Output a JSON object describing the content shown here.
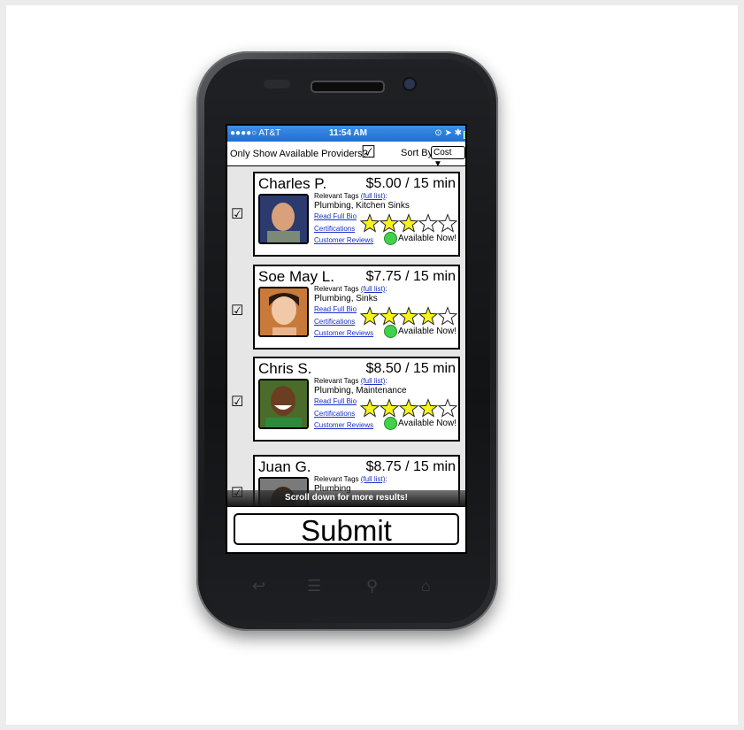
{
  "status_bar": {
    "carrier": "●●●●○ AT&T",
    "time": "11:54 AM",
    "battery_color": "#4ad04a"
  },
  "filter": {
    "available_label": "Only Show Available Providers?",
    "available_checked": true,
    "sort_label": "Sort By:",
    "sort_value": "Cost ▼"
  },
  "tags_label": "Relevant Tags",
  "full_list_link": "(full list)",
  "links": {
    "bio": "Read Full Bio",
    "certs": "Certifications",
    "reviews": "Customer Reviews"
  },
  "available_text": "Available Now!",
  "providers": [
    {
      "name": "Charles P.",
      "price": "$5.00 / 15 min",
      "tags": "Plumbing, Kitchen Sinks",
      "rating": 3,
      "checked": true
    },
    {
      "name": "Soe May L.",
      "price": "$7.75 / 15 min",
      "tags": "Plumbing, Sinks",
      "rating": 4,
      "checked": true
    },
    {
      "name": "Chris S.",
      "price": "$8.50 / 15 min",
      "tags": "Plumbing, Maintenance",
      "rating": 4,
      "checked": true
    },
    {
      "name": "Juan G.",
      "price": "$8.75 / 15 min",
      "tags": "Plumbing",
      "rating": 0,
      "checked": true
    }
  ],
  "scroll_hint": "Scroll down for more results!",
  "submit_label": "Submit",
  "colors": {
    "available_dot": "#3fd24a",
    "star_fill": "#f7f21a",
    "link": "#1a2fc9",
    "status_bar": "#2a7de0"
  },
  "icons": {
    "checkbox": "☑",
    "back": "back-icon",
    "menu": "menu-icon",
    "search": "search-icon",
    "home": "home-icon"
  }
}
